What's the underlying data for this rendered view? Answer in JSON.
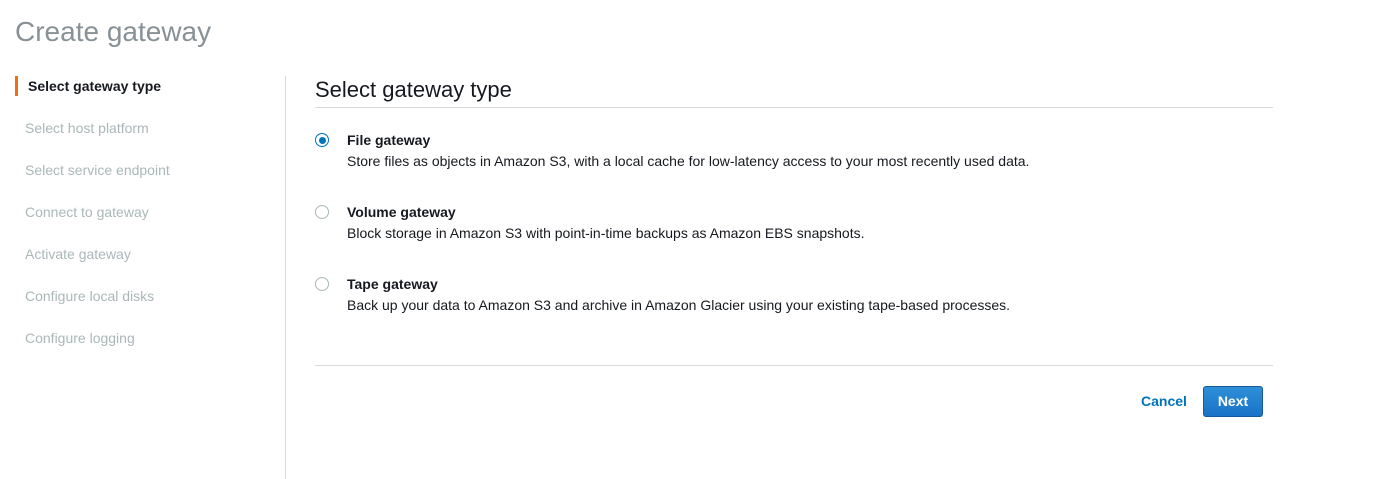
{
  "page": {
    "title": "Create gateway"
  },
  "sidebar": {
    "steps": [
      {
        "label": "Select gateway type",
        "active": true
      },
      {
        "label": "Select host platform",
        "active": false
      },
      {
        "label": "Select service endpoint",
        "active": false
      },
      {
        "label": "Connect to gateway",
        "active": false
      },
      {
        "label": "Activate gateway",
        "active": false
      },
      {
        "label": "Configure local disks",
        "active": false
      },
      {
        "label": "Configure logging",
        "active": false
      }
    ]
  },
  "main": {
    "title": "Select gateway type",
    "options": [
      {
        "label": "File gateway",
        "description": "Store files as objects in Amazon S3, with a local cache for low-latency access to your most recently used data.",
        "selected": true
      },
      {
        "label": "Volume gateway",
        "description": "Block storage in Amazon S3 with point-in-time backups as Amazon EBS snapshots.",
        "selected": false
      },
      {
        "label": "Tape gateway",
        "description": "Back up your data to Amazon S3 and archive in Amazon Glacier using your existing tape-based processes.",
        "selected": false
      }
    ]
  },
  "footer": {
    "cancel_label": "Cancel",
    "next_label": "Next"
  },
  "colors": {
    "accent": "#ec7211",
    "link": "#0073bb",
    "primary_button": "#1a73c8",
    "disabled_text": "#aab7b8"
  }
}
